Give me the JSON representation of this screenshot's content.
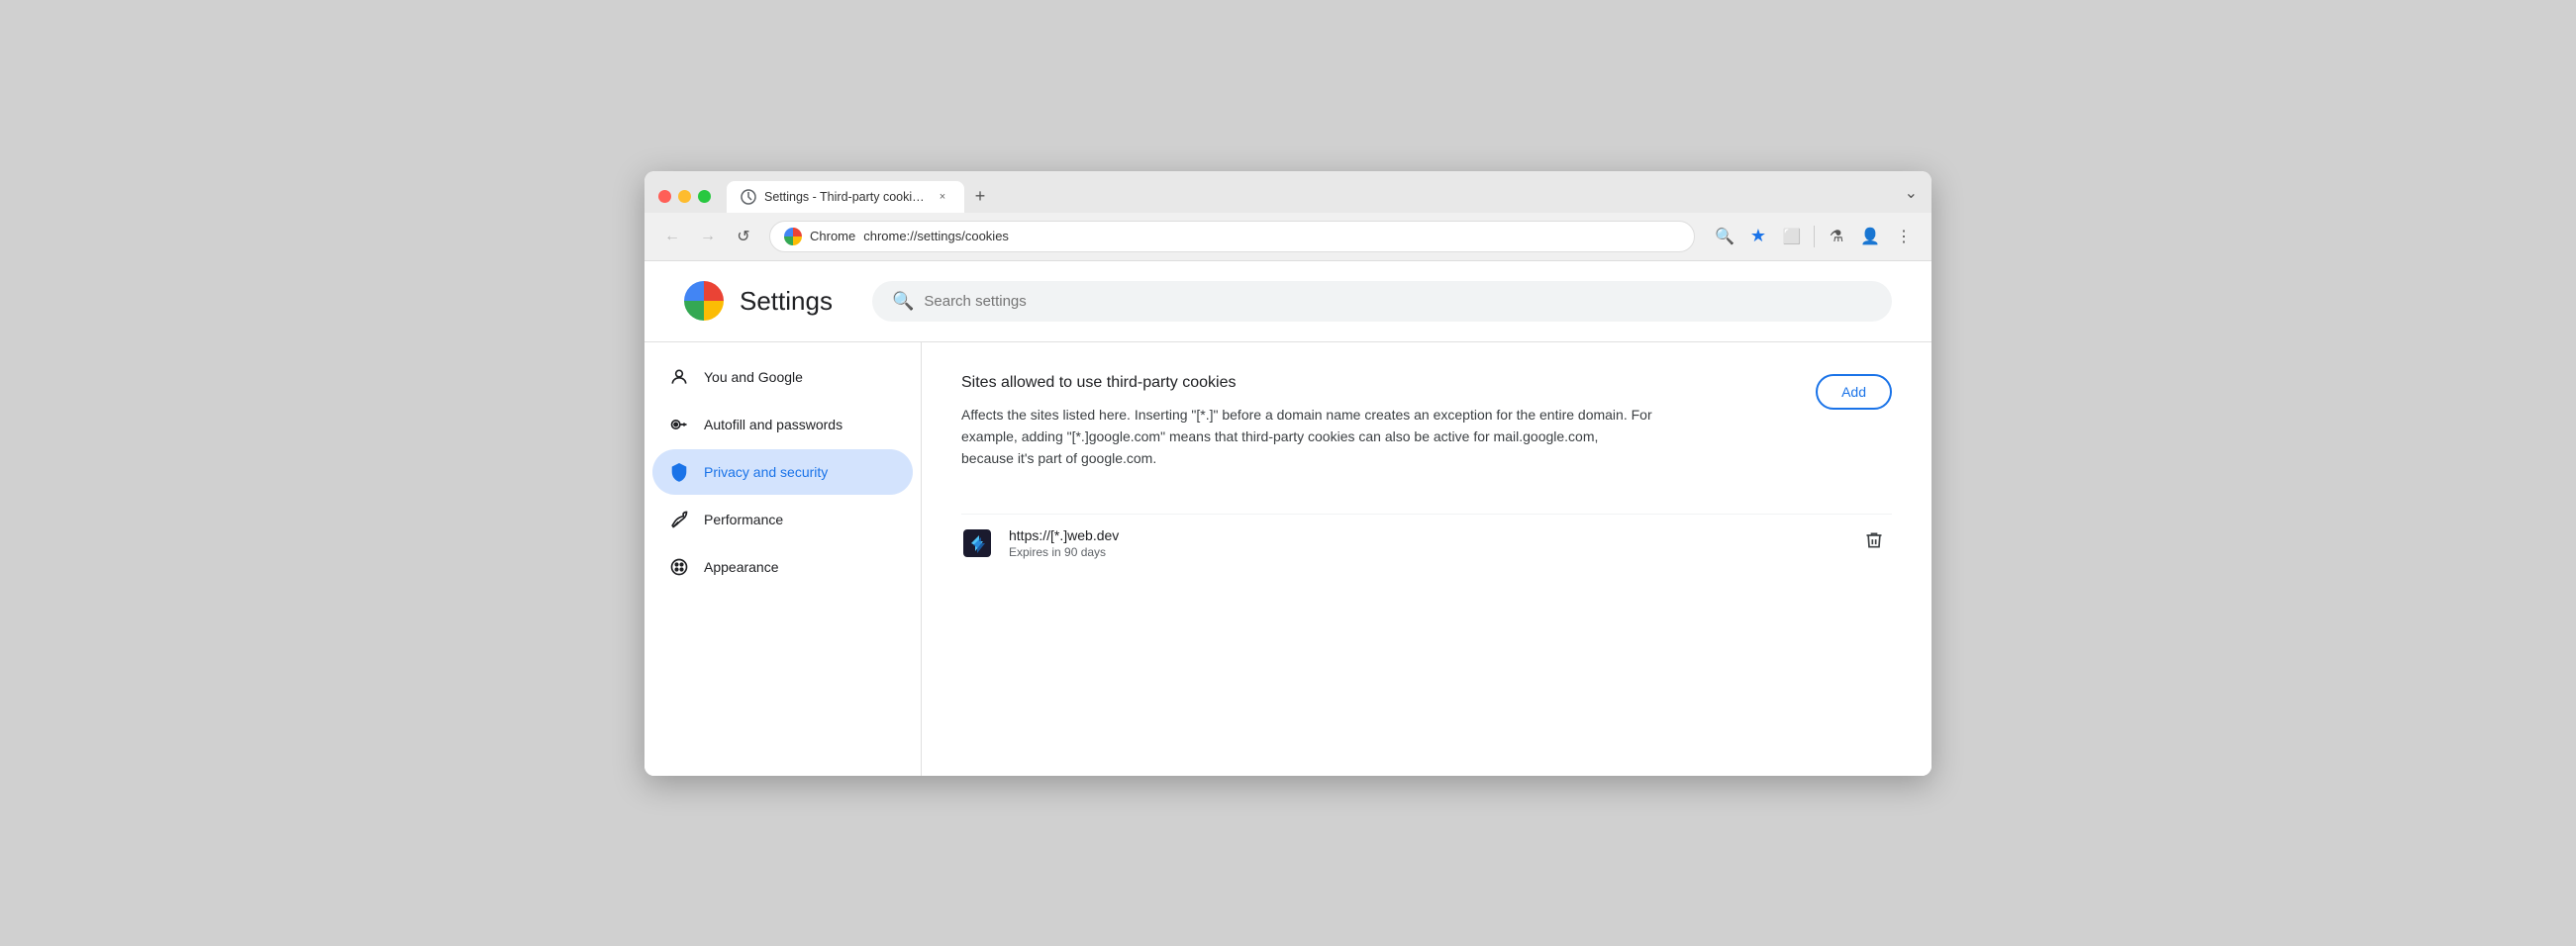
{
  "browser": {
    "tab": {
      "title": "Settings - Third-party cookie…",
      "close_label": "×",
      "new_tab_label": "+"
    },
    "window_dropdown_label": "⌄",
    "toolbar": {
      "back_label": "←",
      "forward_label": "→",
      "reload_label": "↺",
      "chrome_label": "Chrome",
      "url": "chrome://settings/cookies",
      "zoom_icon": "🔍",
      "bookmark_icon": "★",
      "extensions_icon": "□",
      "labs_icon": "⚗",
      "account_icon": "👤",
      "menu_icon": "⋮"
    }
  },
  "settings": {
    "logo_alt": "Chrome settings logo",
    "title": "Settings",
    "search": {
      "placeholder": "Search settings"
    },
    "sidebar": {
      "items": [
        {
          "id": "you-and-google",
          "label": "You and Google",
          "icon": "person"
        },
        {
          "id": "autofill",
          "label": "Autofill and passwords",
          "icon": "key"
        },
        {
          "id": "privacy",
          "label": "Privacy and security",
          "icon": "shield",
          "active": true
        },
        {
          "id": "performance",
          "label": "Performance",
          "icon": "leaf"
        },
        {
          "id": "appearance",
          "label": "Appearance",
          "icon": "palette"
        }
      ]
    },
    "main": {
      "section_title": "Sites allowed to use third-party cookies",
      "description": "Affects the sites listed here. Inserting \"[*.]\" before a domain name creates an exception for the entire domain. For example, adding \"[*.]google.com\" means that third-party cookies can also be active for mail.google.com, because it's part of google.com.",
      "add_button_label": "Add",
      "sites": [
        {
          "url": "https://[*.]web.dev",
          "expiry": "Expires in 90 days"
        }
      ]
    }
  }
}
